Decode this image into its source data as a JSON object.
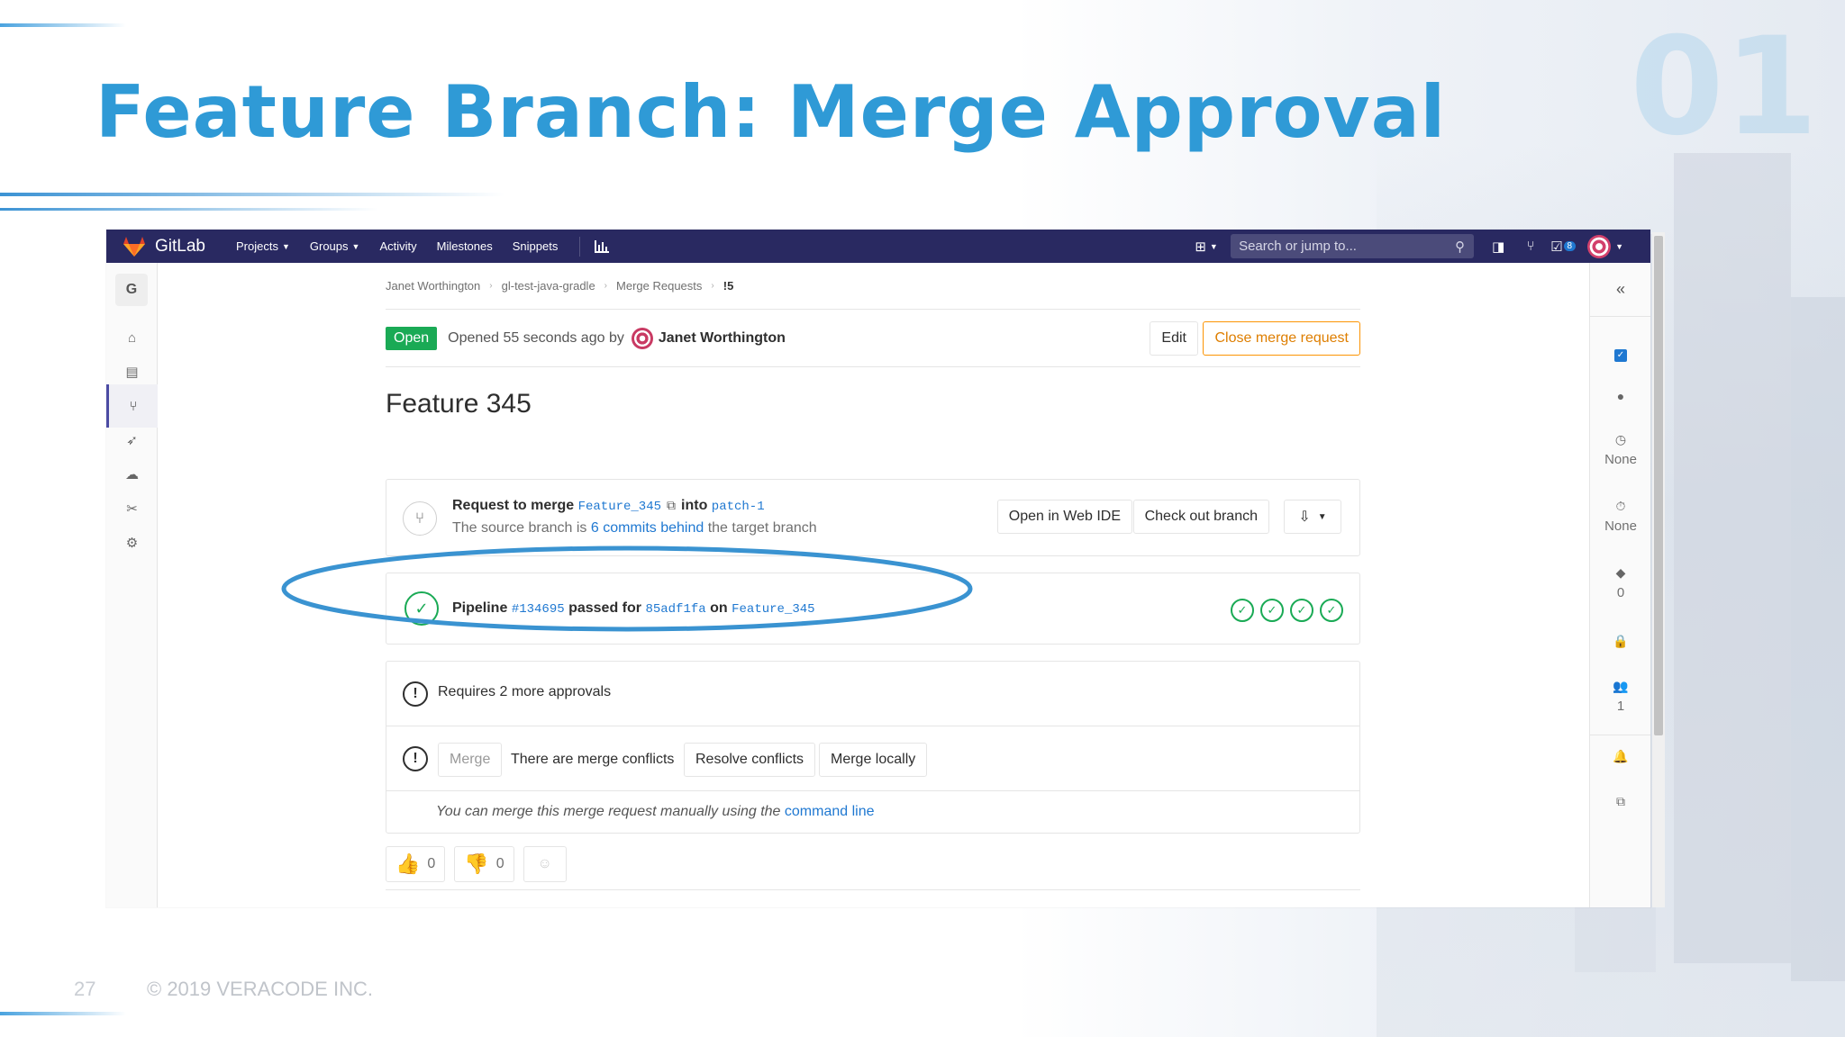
{
  "slide": {
    "title": "Feature Branch: Merge Approval",
    "section_number": "01",
    "page_number": "27",
    "copyright": "© 2019 VERACODE INC.",
    "accent_color": "#2f9ad6"
  },
  "navbar": {
    "brand": "GitLab",
    "items": [
      {
        "label": "Projects",
        "has_dropdown": true
      },
      {
        "label": "Groups",
        "has_dropdown": true
      },
      {
        "label": "Activity",
        "has_dropdown": false
      },
      {
        "label": "Milestones",
        "has_dropdown": false
      },
      {
        "label": "Snippets",
        "has_dropdown": false
      }
    ],
    "search_placeholder": "Search or jump to...",
    "todo_count": "8",
    "bg_color": "#292961"
  },
  "left_sidebar": {
    "project_initial": "G"
  },
  "breadcrumb": [
    "Janet Worthington",
    "gl-test-java-gradle",
    "Merge Requests",
    "!5"
  ],
  "mr": {
    "status": "Open",
    "opened_text": "Opened 55 seconds ago by",
    "author": "Janet Worthington",
    "edit_label": "Edit",
    "close_label": "Close merge request",
    "title": "Feature 345"
  },
  "branch_widget": {
    "prefix": "Request to merge",
    "source": "Feature_345",
    "into": "into",
    "target": "patch-1",
    "behind_prefix": "The source branch is",
    "behind_link": "6 commits behind",
    "behind_suffix": "the target branch",
    "web_ide_label": "Open in Web IDE",
    "checkout_label": "Check out branch"
  },
  "pipeline_widget": {
    "label": "Pipeline",
    "id": "#134695",
    "passed_for": "passed for",
    "commit": "85adf1fa",
    "on": "on",
    "branch": "Feature_345",
    "stage_count": 4
  },
  "merge_widget": {
    "approvals_text": "Requires 2 more approvals",
    "merge_label": "Merge",
    "conflict_text": "There are merge conflicts",
    "resolve_label": "Resolve conflicts",
    "local_label": "Merge locally",
    "manual_text": "You can merge this merge request manually using the",
    "manual_link": "command line"
  },
  "awards": {
    "thumbs_up": "0",
    "thumbs_down": "0"
  },
  "right_sidebar": {
    "milestone": "None",
    "time_tracking": "None",
    "labels_count": "0",
    "participants_count": "1"
  }
}
